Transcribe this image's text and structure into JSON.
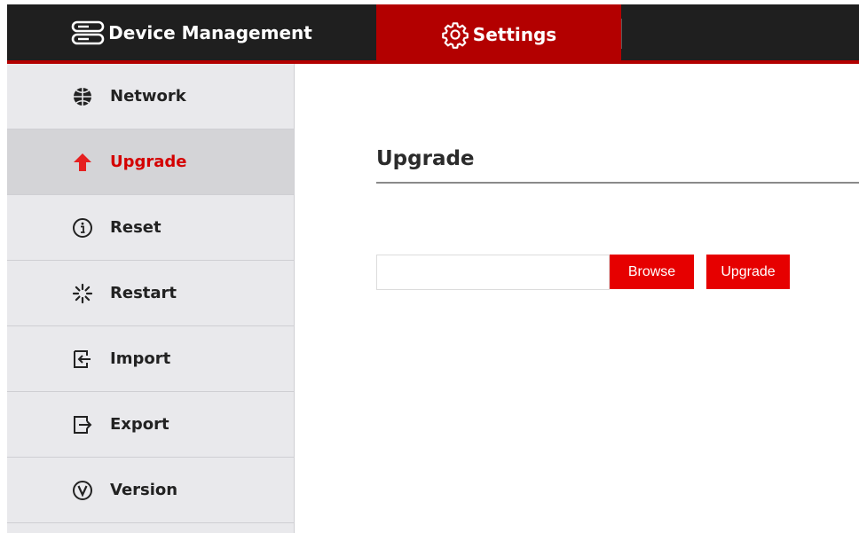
{
  "header": {
    "tabs": [
      {
        "label": "Device Management",
        "icon": "server-stack-icon",
        "active": false
      },
      {
        "label": "Settings",
        "icon": "gear-icon",
        "active": true
      }
    ]
  },
  "sidebar": {
    "items": [
      {
        "label": "Network",
        "icon": "globe-icon",
        "active": false
      },
      {
        "label": "Upgrade",
        "icon": "arrow-up-icon",
        "active": true
      },
      {
        "label": "Reset",
        "icon": "info-icon",
        "active": false
      },
      {
        "label": "Restart",
        "icon": "loading-spinner-icon",
        "active": false
      },
      {
        "label": "Import",
        "icon": "import-icon",
        "active": false
      },
      {
        "label": "Export",
        "icon": "export-icon",
        "active": false
      },
      {
        "label": "Version",
        "icon": "version-v-icon",
        "active": false
      }
    ]
  },
  "main": {
    "title": "Upgrade",
    "file_input": {
      "value": "",
      "placeholder": ""
    },
    "browse_label": "Browse",
    "upgrade_label": "Upgrade"
  },
  "colors": {
    "topbar_bg": "#1f1f1f",
    "accent_red": "#b30000",
    "button_red": "#e60000",
    "active_text": "#d40000",
    "sidebar_bg": "#e9e9ec"
  }
}
